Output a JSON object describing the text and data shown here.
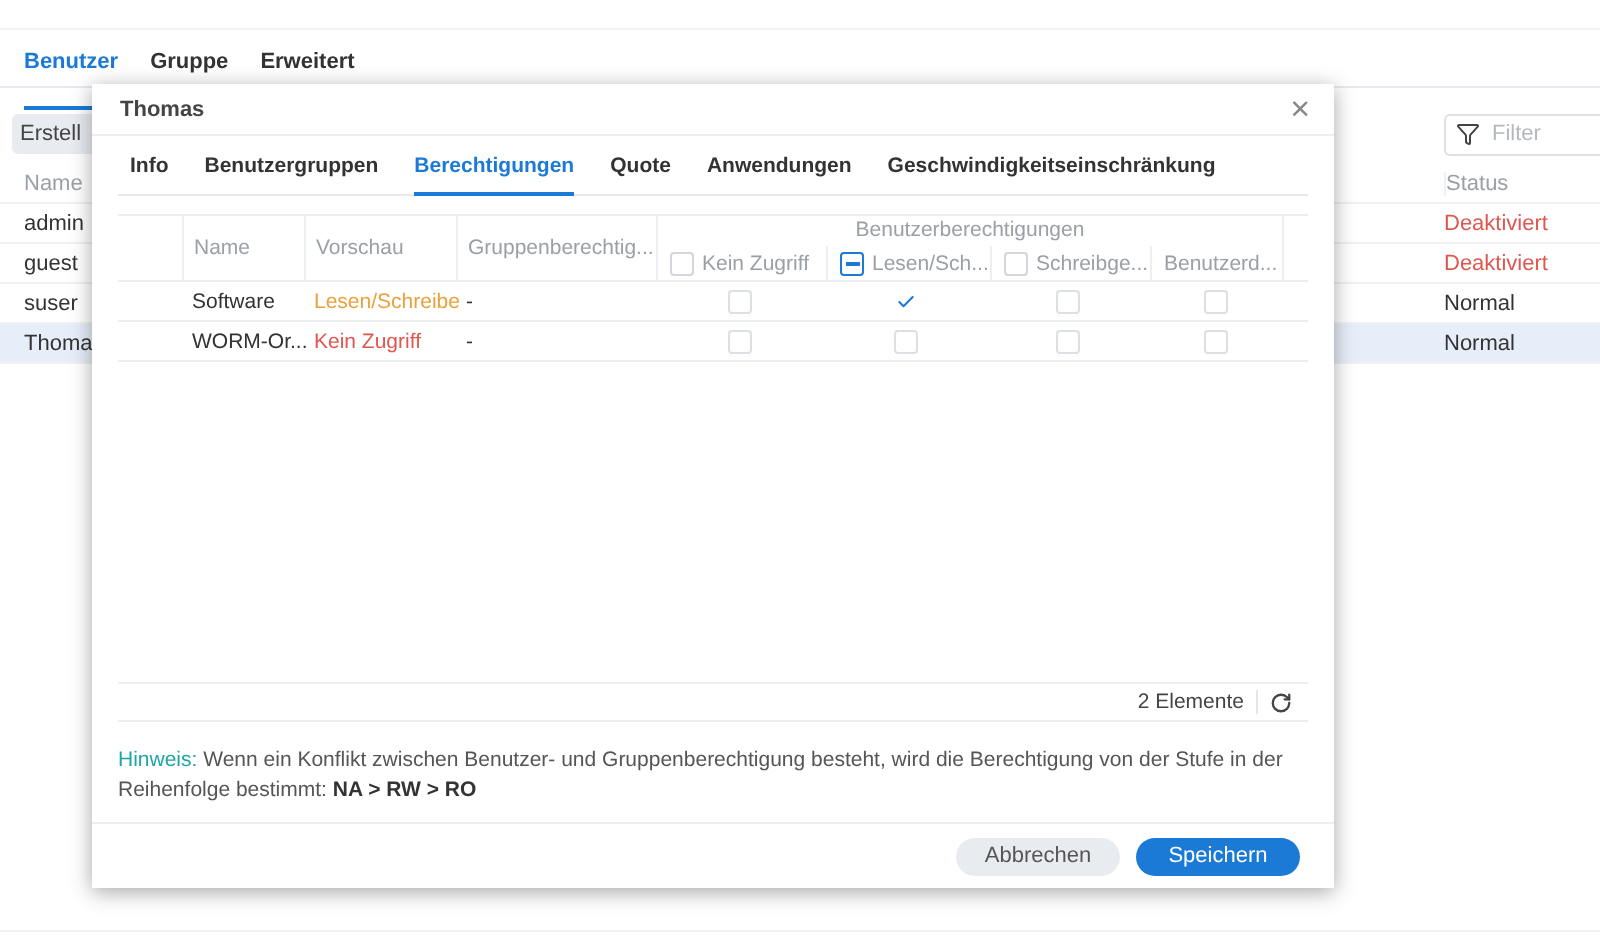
{
  "main_tabs": [
    {
      "label": "Benutzer",
      "selected": true
    },
    {
      "label": "Gruppe",
      "selected": false
    },
    {
      "label": "Erweitert",
      "selected": false
    }
  ],
  "toolbar": {
    "create_button": "Erstell",
    "filter": {
      "placeholder": "Filter"
    }
  },
  "users_table": {
    "columns": [
      "Name",
      "Status"
    ],
    "rows": [
      {
        "name": "admin",
        "status": "Deaktiviert",
        "disabled": true,
        "selected": false
      },
      {
        "name": "guest",
        "status": "Deaktiviert",
        "disabled": true,
        "selected": false
      },
      {
        "name": "suser",
        "status": "Normal",
        "disabled": false,
        "selected": false
      },
      {
        "name": "Thoma",
        "status": "Normal",
        "disabled": false,
        "selected": true
      }
    ]
  },
  "dialog": {
    "title": "Thomas",
    "close": "×",
    "tabs": [
      {
        "label": "Info",
        "selected": false
      },
      {
        "label": "Benutzergruppen",
        "selected": false
      },
      {
        "label": "Berechtigungen",
        "selected": true
      },
      {
        "label": "Quote",
        "selected": false
      },
      {
        "label": "Anwendungen",
        "selected": false
      },
      {
        "label": "Geschwindigkeitseinschränkung",
        "selected": false
      }
    ],
    "table": {
      "columns": [
        "Name",
        "Vorschau",
        "Gruppenberechtig..."
      ],
      "group_header": "Benutzerberechtigungen",
      "permission_columns": [
        {
          "label": "Kein Zugriff",
          "checkbox": {
            "indeterminate": false
          }
        },
        {
          "label": "Lesen/Sch...",
          "checkbox": {
            "indeterminate": true
          }
        },
        {
          "label": "Schreibge...",
          "checkbox": {
            "indeterminate": false
          }
        },
        {
          "label": "Benutzerd..."
        }
      ],
      "rows": [
        {
          "name": "Software",
          "preview": "Lesen/Schreibe",
          "color": "#e8a23a",
          "group": "-",
          "permissions": [
            {
              "checked": false
            },
            {
              "checked": true
            },
            {
              "checked": false
            },
            {
              "checked": false
            }
          ]
        },
        {
          "name": "WORM-Or...",
          "preview": "Kein Zugriff",
          "color": "#e0574f",
          "group": "-",
          "permissions": [
            {
              "checked": false
            },
            {
              "checked": false
            },
            {
              "checked": false
            },
            {
              "checked": false
            }
          ]
        }
      ],
      "count": "2 Elemente"
    },
    "note": {
      "label": "Hinweis:",
      "text": "Wenn ein Konflikt zwischen Benutzer- und Gruppenberechtigung besteht, wird die Berechtigung von der Stufe in der Reihenfolge bestimmt: **NA > RW > RO**"
    },
    "buttons": [
      {
        "label": "Abbrechen",
        "kind": "secondary"
      },
      {
        "label": "Speichern",
        "kind": "primary"
      }
    ]
  }
}
